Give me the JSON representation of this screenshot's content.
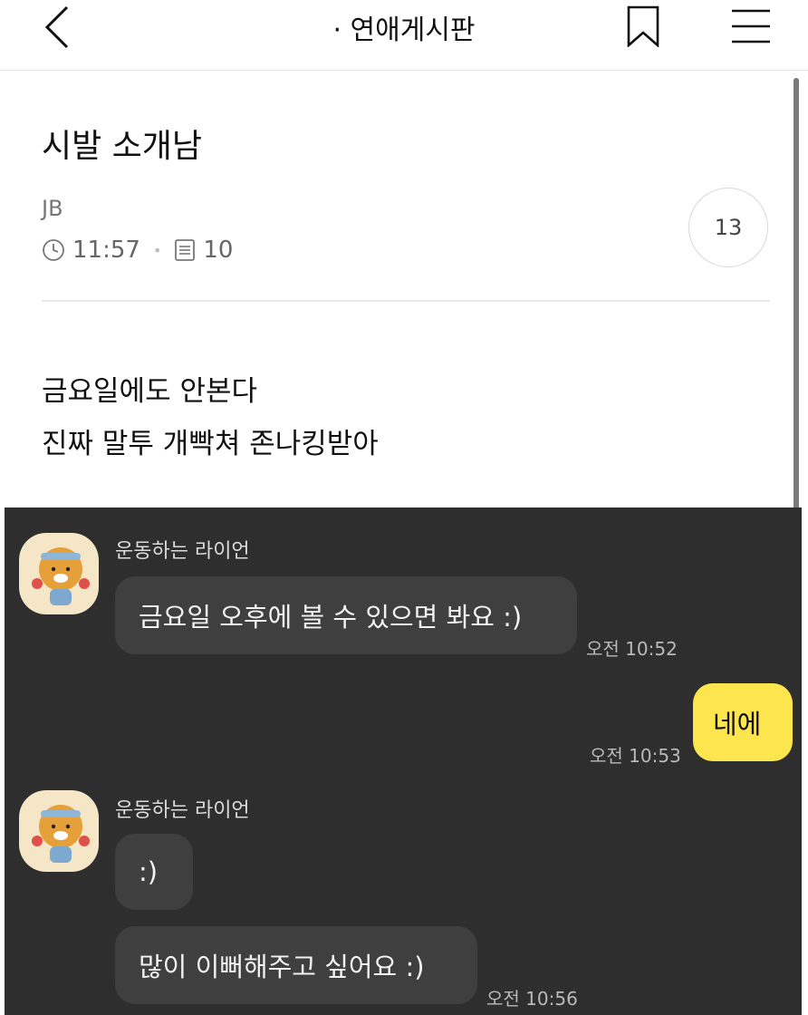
{
  "header": {
    "board_title": "· 연애게시판",
    "icons": [
      "chevron-left-icon",
      "bookmark-icon",
      "hamburger-menu-icon"
    ]
  },
  "post": {
    "title": "시발 소개남",
    "author": "JB",
    "time": "11:57",
    "views": "10",
    "comment_count": "13",
    "body_lines": [
      "금요일에도 안본다",
      "진짜 말투 개빡쳐 존나킹받아"
    ]
  },
  "chat": {
    "messages": [
      {
        "sender": "운동하는 라이언",
        "text": "금요일 오후에 볼 수 있으면 봐요 :)",
        "time": "오전 10:52"
      },
      {
        "sender": "me",
        "text": "네에",
        "time": "오전 10:53"
      },
      {
        "sender": "운동하는 라이언",
        "text": ":)",
        "time": ""
      },
      {
        "sender": "운동하는 라이언",
        "text": "많이 이뻐해주고 싶어요 :)",
        "time": "오전 10:56"
      }
    ],
    "colors": {
      "background": "#2e2e2e",
      "incoming_bubble": "#3f3f3f",
      "outgoing_bubble": "#fde54d"
    }
  }
}
